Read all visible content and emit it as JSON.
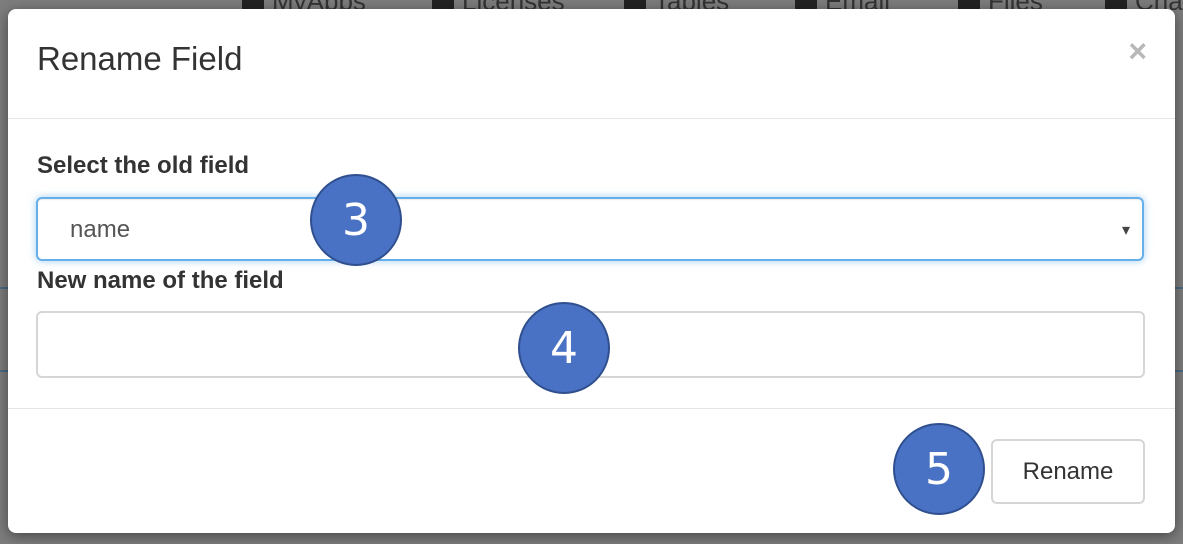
{
  "background": {
    "nav_items": [
      {
        "label": "MyApps",
        "icon": "cloud-icon"
      },
      {
        "label": "Licenses",
        "icon": "document-icon"
      },
      {
        "label": "Tables",
        "icon": "database-icon"
      },
      {
        "label": "Email",
        "icon": "envelope-icon"
      },
      {
        "label": "Files",
        "icon": "file-icon"
      },
      {
        "label": "Cha",
        "icon": "chat-icon"
      }
    ]
  },
  "modal": {
    "title": "Rename Field",
    "close_glyph": "×",
    "old_field": {
      "label": "Select the old field",
      "selected_value": "name",
      "arrow_glyph": "▾"
    },
    "new_field": {
      "label": "New name of the field",
      "value": "",
      "placeholder": ""
    },
    "submit_label": "Rename"
  },
  "callouts": {
    "select_step": "3",
    "input_step": "4",
    "button_step": "5",
    "color": "#4a72c4"
  }
}
